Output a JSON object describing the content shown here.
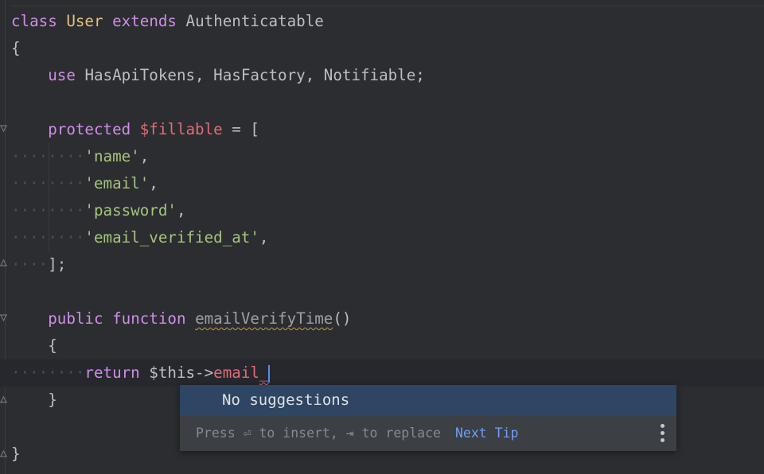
{
  "code": {
    "l1": {
      "kw": "class",
      "cls": "User",
      "kw2": "extends",
      "parent": "Authenticatable"
    },
    "l2": {
      "text": "{"
    },
    "l3": {
      "kw": "use",
      "rest": "HasApiTokens, HasFactory, Notifiable;"
    },
    "l5": {
      "kw": "protected",
      "var": "$fillable",
      "rest": " = ["
    },
    "l6": {
      "str": "'name'",
      "punct": ","
    },
    "l7": {
      "str": "'email'",
      "punct": ","
    },
    "l8": {
      "str": "'password'",
      "punct": ","
    },
    "l9": {
      "str": "'email_verified_at'",
      "punct": ","
    },
    "l10": {
      "text": "];"
    },
    "l12": {
      "kw": "public",
      "kw2": "function",
      "fn": "emailVerifyTime",
      "rest": "()"
    },
    "l13": {
      "text": "{"
    },
    "l14": {
      "kw": "return",
      "obj": "$this->",
      "prop": "email",
      "typed": "_"
    },
    "l15": {
      "text": "}"
    },
    "l17": {
      "text": "}"
    }
  },
  "popup": {
    "message": "No suggestions",
    "footer": "Press ⏎ to insert, ⇥ to replace",
    "next_tip": "Next Tip"
  },
  "icons": {
    "fold": "fold-marker-icon",
    "more": "more-vertical-icon"
  },
  "colors": {
    "background": "#2b2d30",
    "keyword": "#cf8ee8",
    "class": "#e8c07d",
    "variable": "#e06c75",
    "string": "#a6c47e",
    "selection": "#2e4563",
    "link": "#6e9ef5"
  }
}
